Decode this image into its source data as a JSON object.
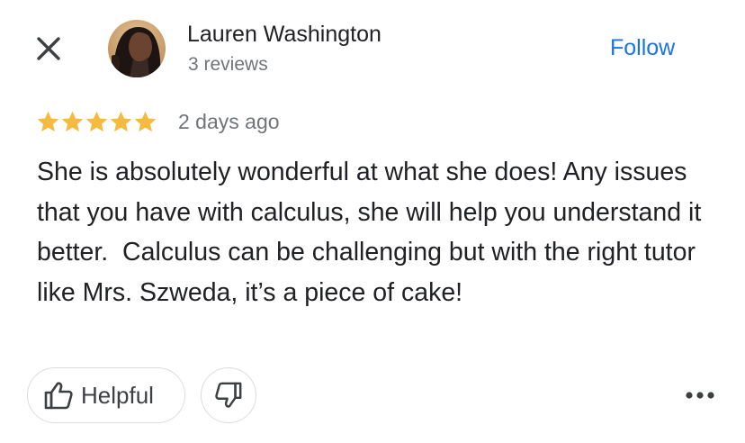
{
  "header": {
    "close_icon": "close-icon",
    "author": {
      "name": "Lauren Washington",
      "review_count": "3 reviews"
    },
    "follow_label": "Follow"
  },
  "review": {
    "rating": 5,
    "rating_max": 5,
    "time_ago": "2 days ago",
    "text": "She is absolutely wonderful at what she does! Any issues that you have with calculus, she will help you understand it better.  Calculus can be challenging but with the right tutor like Mrs. Szweda, it’s a piece of cake!"
  },
  "actions": {
    "helpful_label": "Helpful",
    "helpful_icon": "thumbs-up-icon",
    "unhelpful_icon": "thumbs-down-icon",
    "more_icon": "more-horizontal-icon"
  },
  "colors": {
    "accent": "#1a73e8",
    "star": "#f5bb41",
    "text_primary": "#202124",
    "text_secondary": "#70757a",
    "border": "#dadce0"
  }
}
